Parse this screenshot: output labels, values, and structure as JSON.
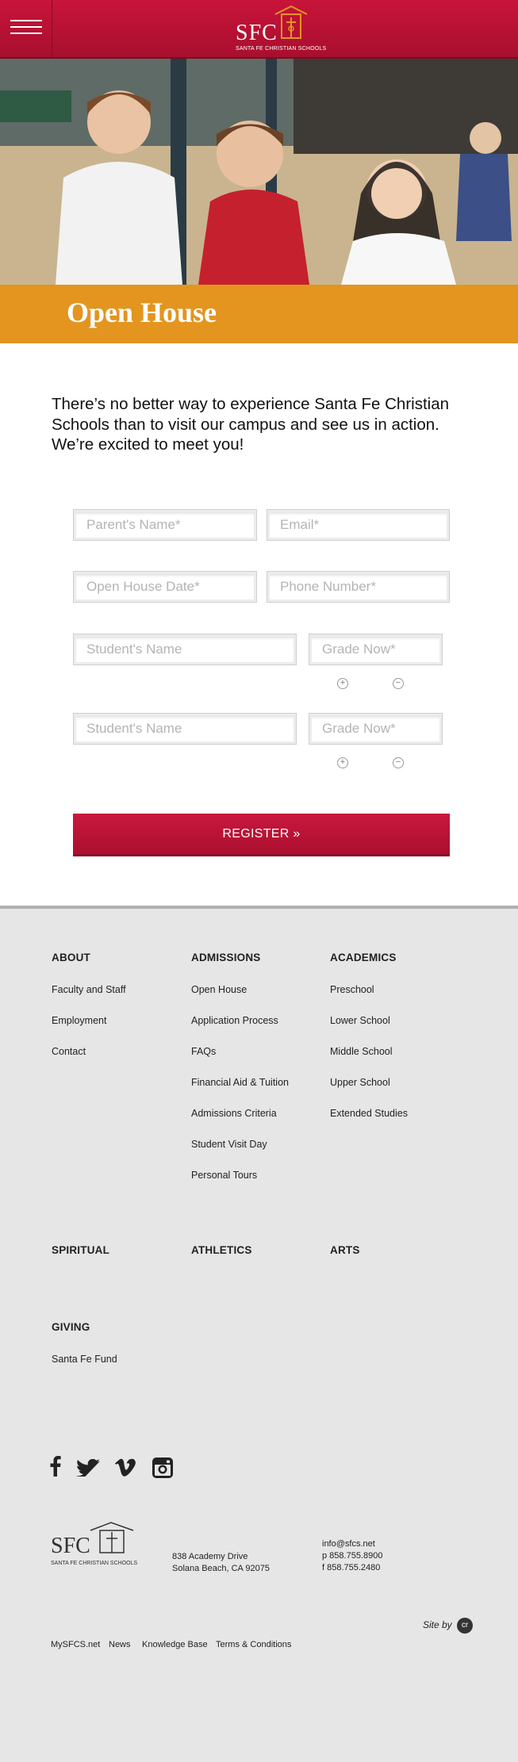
{
  "header": {
    "logo_text": "SFC",
    "logo_subtitle": "SANTA FE CHRISTIAN SCHOOLS"
  },
  "page": {
    "title": "Open House",
    "intro": "There’s no better way to experience Santa Fe Christian Schools than to visit our campus and see us in action. We’re excited to meet you!"
  },
  "form": {
    "parent_name_placeholder": "Parent's Name*",
    "email_placeholder": "Email*",
    "date_placeholder": "Open House Date*",
    "phone_placeholder": "Phone Number*",
    "students": [
      {
        "name_placeholder": "Student's Name",
        "grade_placeholder": "Grade Now*"
      },
      {
        "name_placeholder": "Student's Name",
        "grade_placeholder": "Grade Now*"
      }
    ],
    "add_symbol": "+",
    "remove_symbol": "−",
    "register_label": "REGISTER »"
  },
  "footer": {
    "about": {
      "title": "ABOUT",
      "links": [
        "Faculty and Staff",
        "Employment",
        "Contact"
      ]
    },
    "admissions": {
      "title": "ADMISSIONS",
      "links": [
        "Open House",
        "Application Process",
        "FAQs",
        "Financial Aid & Tuition",
        "Admissions Criteria",
        "Student Visit Day",
        "Personal Tours"
      ]
    },
    "academics": {
      "title": "ACADEMICS",
      "links": [
        "Preschool",
        "Lower School",
        "Middle School",
        "Upper School",
        "Extended Studies"
      ]
    },
    "spiritual": {
      "title": "SPIRITUAL"
    },
    "athletics": {
      "title": "ATHLETICS"
    },
    "arts": {
      "title": "ARTS"
    },
    "giving": {
      "title": "GIVING",
      "links": [
        "Santa Fe Fund"
      ]
    },
    "social_icons": [
      "facebook-icon",
      "twitter-icon",
      "vimeo-icon",
      "instagram-icon"
    ],
    "logo_text": "SFC",
    "logo_subtitle": "SANTA FE CHRISTIAN SCHOOLS",
    "address_line1": "838 Academy Drive",
    "address_line2": "Solana Beach, CA 92075",
    "email": "info@sfcs.net",
    "phone": "p  858.755.8900",
    "fax": "f  858.755.2480",
    "site_by": "Site by",
    "site_by_badge": "cr",
    "bottom_links": [
      "MySFCS.net",
      "News",
      "Knowledge Base",
      "Terms & Conditions"
    ]
  },
  "colors": {
    "brand_red": "#b8123a",
    "band_orange": "#e3951f",
    "footer_bg": "#e6e6e6"
  }
}
